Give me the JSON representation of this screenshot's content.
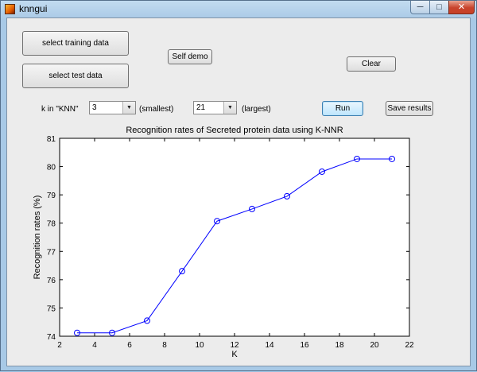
{
  "window": {
    "title": "knngui",
    "min_glyph": "─",
    "max_glyph": "□",
    "close_glyph": "✕"
  },
  "buttons": {
    "select_training": "select training data",
    "select_test": "select test data",
    "self_demo": "Self demo",
    "clear": "Clear",
    "run": "Run",
    "save_results": "Save results"
  },
  "k_controls": {
    "label": "k in \"KNN\"",
    "smallest_value": "3",
    "smallest_label": "(smallest)",
    "largest_value": "21",
    "largest_label": "(largest)"
  },
  "chart_data": {
    "type": "line",
    "title": "Recognition rates of Secreted protein data using K-NNR",
    "xlabel": "K",
    "ylabel": "Recognition rates (%)",
    "xlim": [
      2,
      22
    ],
    "ylim": [
      74,
      81
    ],
    "xticks": [
      2,
      4,
      6,
      8,
      10,
      12,
      14,
      16,
      18,
      20,
      22
    ],
    "yticks": [
      74,
      75,
      76,
      77,
      78,
      79,
      80,
      81
    ],
    "grid": false,
    "legend": "none",
    "color": "#0000ff",
    "marker": "circle",
    "series": [
      {
        "x": [
          3,
          5,
          7,
          9,
          11,
          13,
          15,
          17,
          19,
          21
        ],
        "values": [
          74.12,
          74.12,
          74.55,
          76.3,
          78.07,
          78.5,
          78.95,
          79.82,
          80.27,
          80.27
        ]
      }
    ]
  }
}
